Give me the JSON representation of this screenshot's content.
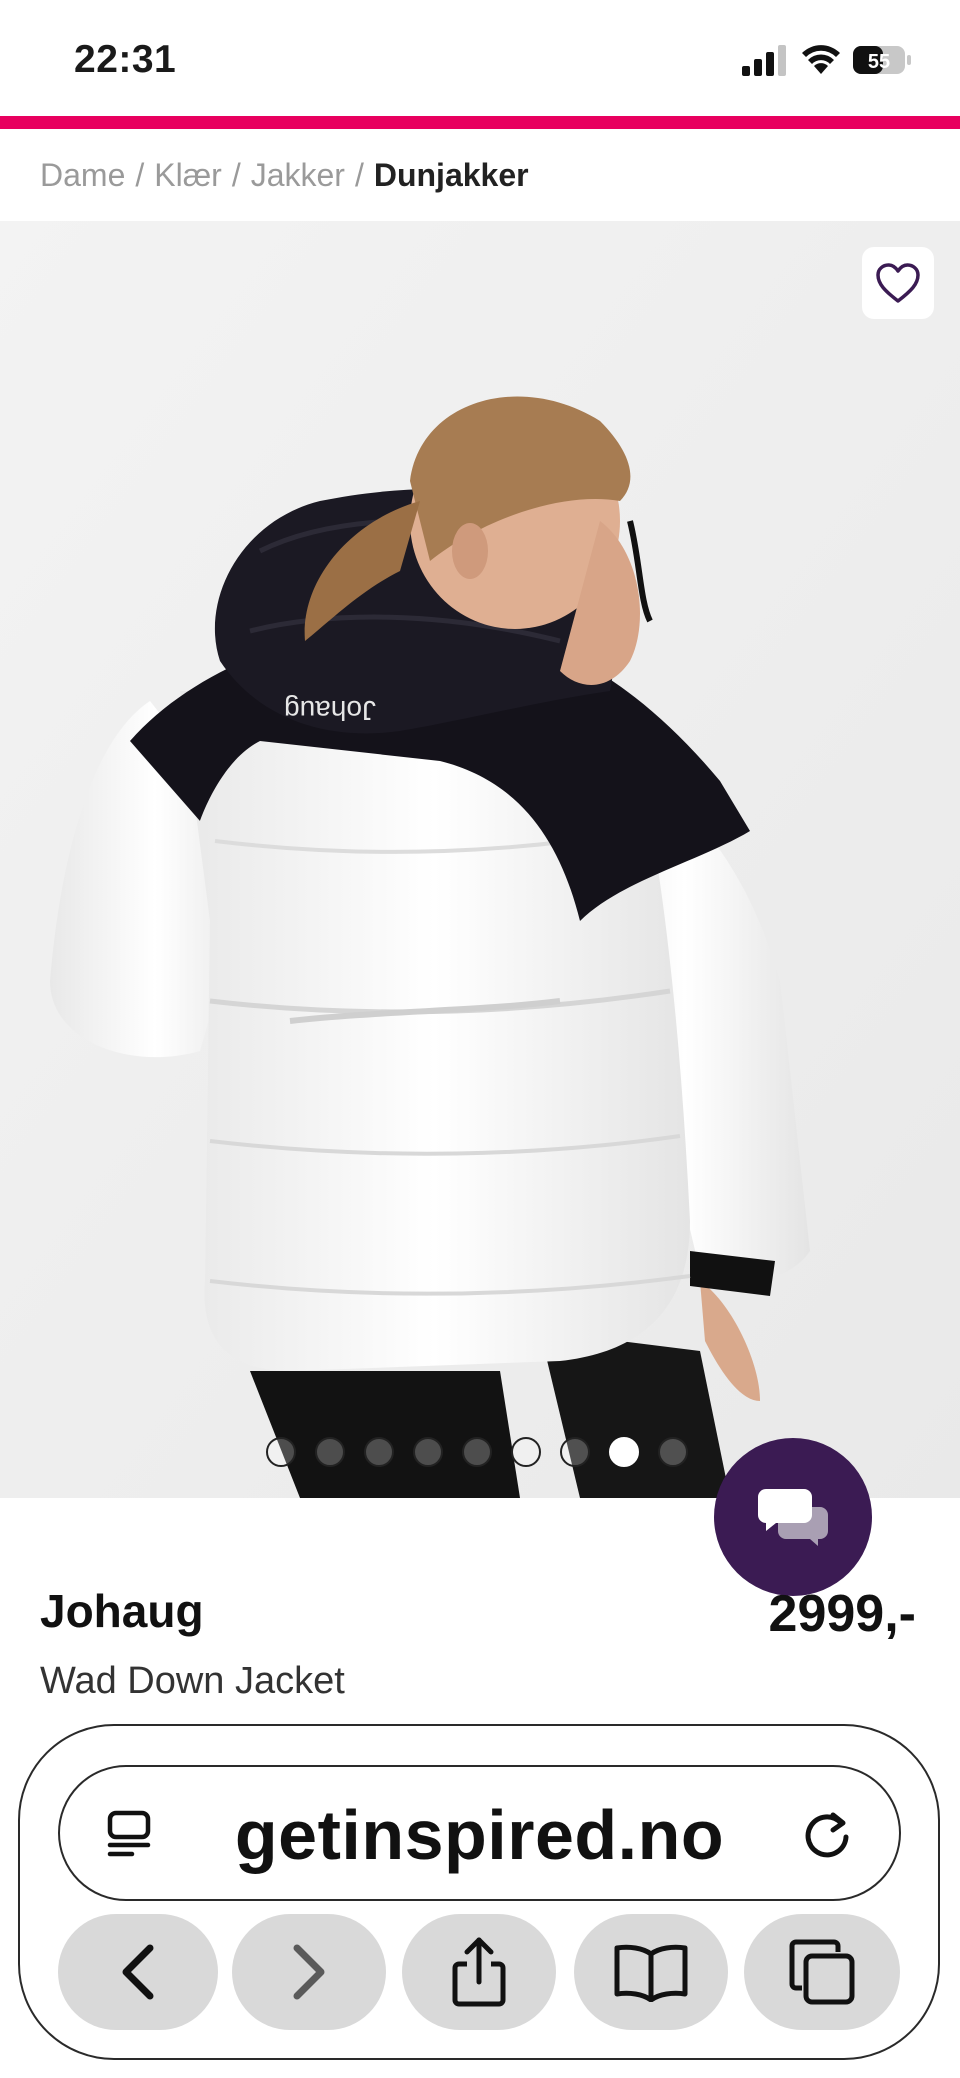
{
  "status_bar": {
    "time": "22:31",
    "battery": "55"
  },
  "breadcrumb": {
    "items": [
      "Dame",
      "Klær",
      "Jakker"
    ],
    "separator": "/",
    "current": "Dunjakker"
  },
  "product": {
    "brand": "Johaug",
    "name": "Wad Down Jacket",
    "price": "2999,-",
    "jacket_print": "Johaug",
    "image_count": 9,
    "active_image_index": 7
  },
  "browser": {
    "url": "getinspired.no"
  },
  "icons": {
    "favorite": "heart-icon",
    "chat": "chat-bubbles-icon",
    "reader": "reader-mode-icon",
    "reload": "reload-icon",
    "back": "chevron-left-icon",
    "forward": "chevron-right-icon",
    "share": "share-icon",
    "bookmarks": "book-icon",
    "tabs": "tabs-icon"
  },
  "colors": {
    "accent": "#e8005f",
    "chat": "#3b1b53"
  }
}
